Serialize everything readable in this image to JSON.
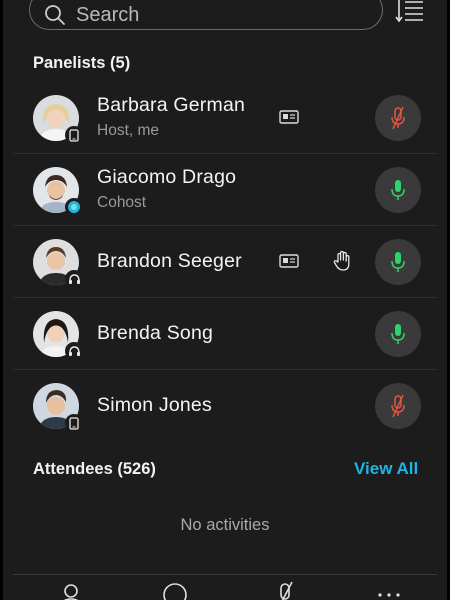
{
  "search": {
    "placeholder": "Search"
  },
  "panelists": {
    "title": "Panelists (5)",
    "items": [
      {
        "name": "Barbara German",
        "role": "Host, me",
        "device": "phone",
        "card": true,
        "hand": false,
        "mic": "muted"
      },
      {
        "name": "Giacomo Drago",
        "role": "Cohost",
        "device": "webex",
        "card": false,
        "hand": false,
        "mic": "on"
      },
      {
        "name": "Brandon Seeger",
        "role": "",
        "device": "headset",
        "card": true,
        "hand": true,
        "mic": "on"
      },
      {
        "name": "Brenda Song",
        "role": "",
        "device": "headset",
        "card": false,
        "hand": false,
        "mic": "on"
      },
      {
        "name": "Simon Jones",
        "role": "",
        "device": "phone",
        "card": false,
        "hand": false,
        "mic": "muted"
      }
    ]
  },
  "attendees": {
    "title": "Attendees (526)",
    "view_all": "View All",
    "empty_text": "No activities"
  },
  "colors": {
    "background": "#1c1c1c",
    "accent": "#1fb4e8",
    "mic_on": "#2bd46a",
    "mic_muted": "#e4573d"
  },
  "icons": [
    "search-icon",
    "sort-icon",
    "id-card-icon",
    "raise-hand-icon",
    "microphone-icon",
    "microphone-muted-icon",
    "person-icon",
    "chat-icon",
    "more-icon"
  ]
}
